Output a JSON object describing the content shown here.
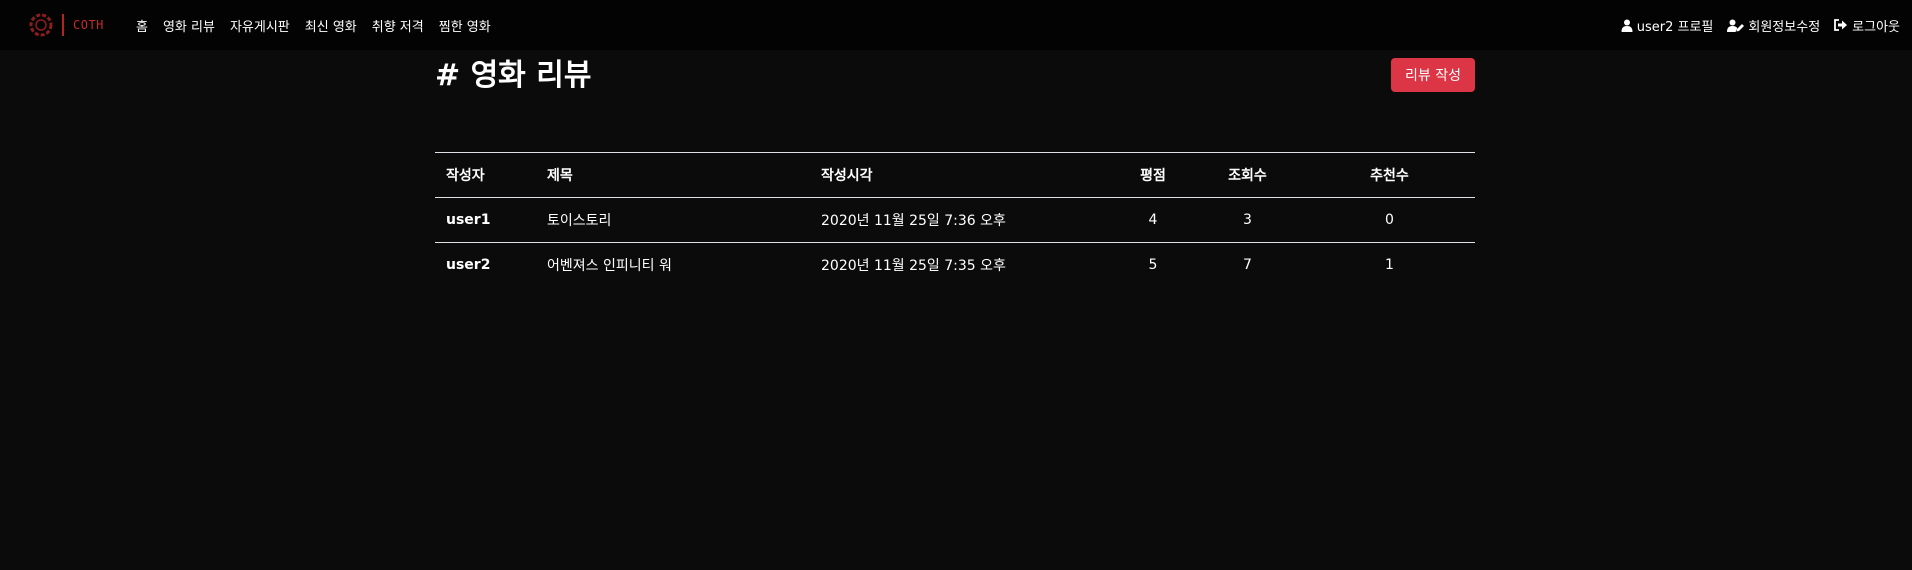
{
  "brand": {
    "name": "COTH",
    "color": "#c62b2b"
  },
  "nav": {
    "links": [
      "홈",
      "영화 리뷰",
      "자유게시판",
      "최신 영화",
      "취향 저격",
      "찜한 영화"
    ],
    "right": [
      {
        "icon": "user-icon",
        "label": "user2 프로필"
      },
      {
        "icon": "user-edit-icon",
        "label": "회원정보수정"
      },
      {
        "icon": "sign-out-icon",
        "label": "로그아웃"
      }
    ]
  },
  "page": {
    "title": "# 영화 리뷰",
    "write_button": "리뷰 작성",
    "accent": "#dc3545"
  },
  "table": {
    "headers": [
      "작성자",
      "제목",
      "작성시각",
      "평점",
      "조회수",
      "추천수"
    ],
    "rows": [
      [
        "user1",
        "토이스토리",
        "2020년 11월 25일 7:36 오후",
        "4",
        "3",
        "0"
      ],
      [
        "user2",
        "어벤져스 인피니티 워",
        "2020년 11월 25일 7:35 오후",
        "5",
        "7",
        "1"
      ]
    ]
  }
}
